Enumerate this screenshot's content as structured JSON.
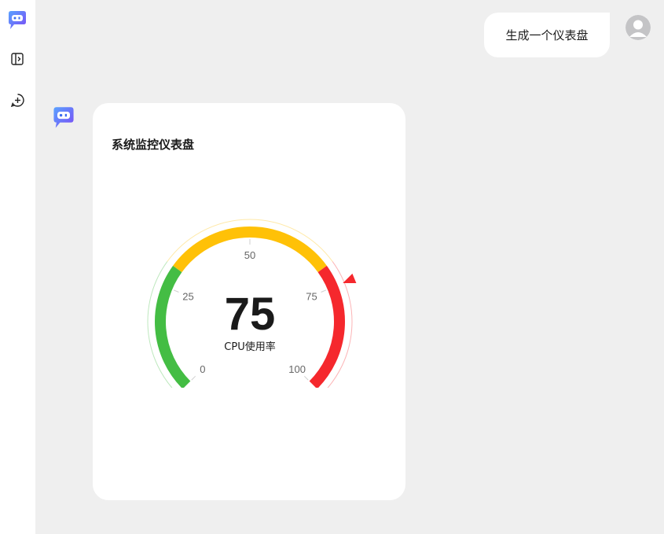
{
  "sidebar": {
    "logo_icon": "robot-chat-icon",
    "toggle_icon": "sidebar-toggle-icon",
    "new_chat_icon": "new-chat-plus-icon"
  },
  "user_message": {
    "text": "生成一个仪表盘"
  },
  "card": {
    "title": "系统监控仪表盘"
  },
  "colors": {
    "green": "#44bd44",
    "yellow": "#ffc107",
    "red": "#f5282d",
    "bg": "#efefef"
  },
  "chart_data": {
    "type": "gauge",
    "min": 0,
    "max": 100,
    "value": 75,
    "value_label": "75",
    "label": "CPU使用率",
    "ticks": [
      "0",
      "25",
      "50",
      "75",
      "100"
    ],
    "tick_values": [
      0,
      25,
      50,
      75,
      100
    ],
    "bands": [
      {
        "from": 0,
        "to": 30,
        "color": "#44bd44"
      },
      {
        "from": 30,
        "to": 70,
        "color": "#ffc107"
      },
      {
        "from": 70,
        "to": 100,
        "color": "#f5282d"
      }
    ]
  }
}
